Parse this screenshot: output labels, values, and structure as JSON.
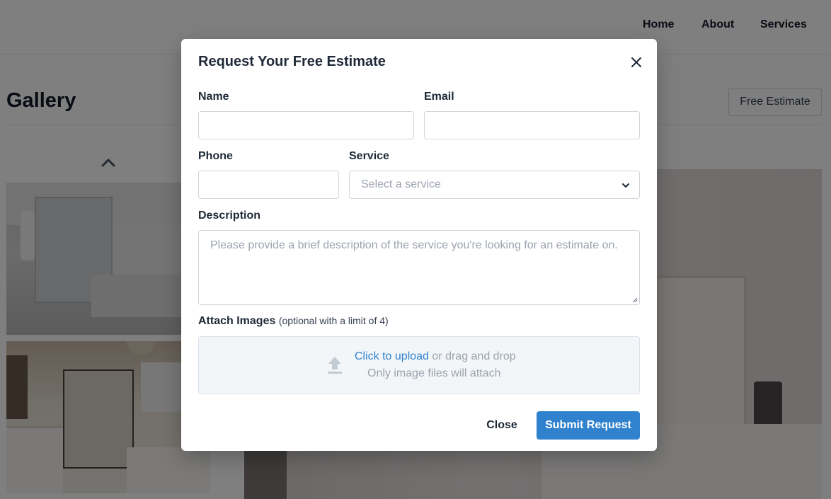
{
  "nav": {
    "home": "Home",
    "about": "About",
    "services": "Services"
  },
  "page": {
    "title": "Gallery",
    "free_estimate_button": "Free Estimate"
  },
  "modal": {
    "title": "Request Your Free Estimate",
    "fields": {
      "name_label": "Name",
      "name_value": "",
      "email_label": "Email",
      "email_value": "",
      "phone_label": "Phone",
      "phone_value": "",
      "service_label": "Service",
      "service_selected": "Select a service",
      "description_label": "Description",
      "description_placeholder": "Please provide a brief description of the service you're looking for an estimate on."
    },
    "attach": {
      "label": "Attach Images",
      "note": "(optional with a limit of 4)",
      "upload_link": "Click to upload",
      "upload_rest": " or drag and drop",
      "hint": "Only image files will attach"
    },
    "close_button": "Close",
    "submit_button": "Submit Request"
  },
  "colors": {
    "primary": "#3182ce",
    "overlay": "rgba(0,0,0,0.5)"
  },
  "icons": {
    "close": "close-icon",
    "chevron_down": "chevron-down-icon",
    "chevron_up": "chevron-up-icon",
    "upload": "upload-icon"
  }
}
